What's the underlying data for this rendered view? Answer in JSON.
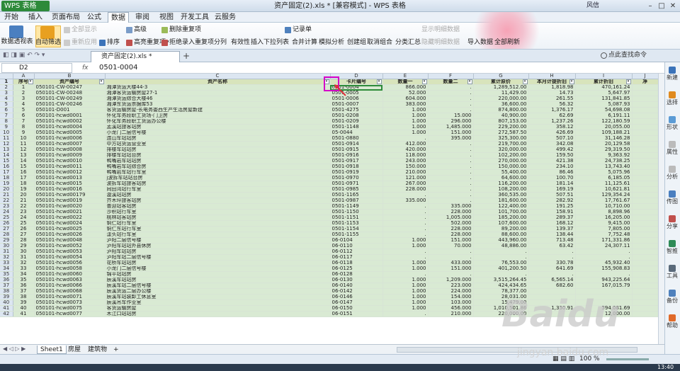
{
  "app": {
    "name": "WPS 表格",
    "title": "资产固定(2).xls * [兼容模式] - WPS 表格",
    "user": "风信14256100766"
  },
  "menus": [
    "开始",
    "插入",
    "页面布局",
    "公式",
    "数据",
    "审阅",
    "视图",
    "开发工具",
    "云服务"
  ],
  "active_menu_index": 4,
  "ribbon": {
    "big": [
      "数据透视表",
      "自动筛选"
    ],
    "small": [
      "全部显示",
      "重新应用",
      "排序",
      "高级",
      "删除重复项",
      "拒绝录入重复项",
      "分列",
      "有效性",
      "插入下拉列表",
      "合并计算",
      "模拟分析",
      "记录单",
      "创建组",
      "取消组合",
      "分类汇总",
      "显示明细数据",
      "隐藏明细数据",
      "导入数据",
      "全部刷新",
      "点此查找命令"
    ]
  },
  "file_tab": "资产固定(2).xls *",
  "name_box": "D2",
  "fx": "fx",
  "formula_value": "0501-0004",
  "columns": [
    "A",
    "B",
    "C",
    "D",
    "E",
    "F",
    "G",
    "H",
    "I",
    "J"
  ],
  "headers": [
    "序号",
    "资产编号",
    "资产名称",
    "卡片编号",
    "数量一",
    "数量二",
    "累计原价",
    "本月计提折旧",
    "累计折旧",
    "净"
  ],
  "rows": [
    [
      "1",
      "050101-CW-00247",
      "湘潭货运大楼44-3",
      "0501-0004",
      "866.000",
      ".",
      "1,289,512.00",
      "1,818.98",
      "470,161.24"
    ],
    [
      "2",
      "050101-CW-00248",
      "湘潭客货运输房屋27-1",
      "0501-0005",
      "52.000",
      ".",
      "11,429.00",
      "14.73",
      "5,647.97"
    ],
    [
      "3",
      "050101-CW-00249",
      "湘潭货运综合大楼46",
      "0501-0006",
      "604.000",
      ".",
      "220,000.00",
      "261.55",
      "131,841.85"
    ],
    [
      "4",
      "050101-CW-00246",
      "湘潭东货运票据库53",
      "0501-0007",
      "383.000",
      ".",
      "36,600.00",
      "56.32",
      "5,087.93"
    ],
    [
      "5",
      "050101-D001",
      "客货运输房屋-长电务委西生产生活房屋新建",
      "0501-4275",
      "1.000",
      ".",
      "874,800.00",
      "1,376.17",
      "54,698.08"
    ],
    [
      "6",
      "050101-hcwd0001",
      "怀化车务段职工货场-门卫房",
      "0501-0208",
      "1.000",
      "15.000",
      "40,900.00",
      "62.69",
      "6,191.11"
    ],
    [
      "7",
      "050101-hcwd0002",
      "怀化车务段职工货运办公楼",
      "0501-0209",
      "1.000",
      "296.000",
      "807,153.00",
      "1,237.26",
      "122,180.59"
    ],
    [
      "8",
      "050101-hcwd0004",
      "孟溪站旅客站房",
      "0501-1148",
      "1.000",
      "1,485.000",
      "229,200.00",
      "358.12",
      "20,055.00"
    ],
    [
      "9",
      "050101-hcwd0005",
      "小龙门二层信号楼",
      "05-0044",
      "1.000",
      "151.000",
      "272,587.50",
      "426.69",
      "109,188.21"
    ],
    [
      "10",
      "050101-hcwd0006",
      "连山车站站房",
      "0501-0880",
      ".",
      "395.000",
      "325,300.00",
      "507.10",
      "31,146.28"
    ],
    [
      "11",
      "050101-hcwd0007",
      "中方站货运营业室",
      "0501-0914",
      "412.000",
      ".",
      "219,700.00",
      "342.08",
      "20,129.58"
    ],
    [
      "12",
      "050101-hcwd0008",
      "排楼车站站房",
      "0501-0915",
      "420.000",
      ".",
      "320,000.00",
      "499.42",
      "29,319.50"
    ],
    [
      "13",
      "050101-hcwd0009",
      "排楼车站站台房",
      "0501-0916",
      "118.000",
      ".",
      "102,200.00",
      "159.50",
      "9,363.92"
    ],
    [
      "14",
      "050101-hcwd0010",
      "鸭嘴岩车站站房",
      "0501-0917",
      "243.000",
      ".",
      "270,000.00",
      "421.38",
      "24,738.25"
    ],
    [
      "15",
      "050101-hcwd0011",
      "鸭嘴岩车站综合房",
      "0501-0918",
      "150.000",
      ".",
      "150,000.00",
      "234.10",
      "13,743.40"
    ],
    [
      "16",
      "050101-hcwd0012",
      "鸭嘴岩车站行车室",
      "0501-0919",
      "210.000",
      ".",
      "55,400.00",
      "86.46",
      "5,075.96"
    ],
    [
      "17",
      "050101-hcwd0013",
      "j波拆车站站台房",
      "0501-0970",
      "121.000",
      ".",
      "64,600.00",
      "100.70",
      "6,185.05"
    ],
    [
      "18",
      "050101-hcwd0015",
      "波拆车站旅客站房",
      "0501-0971",
      "267.000",
      ".",
      "116,200.00",
      "181.14",
      "11,125.61"
    ],
    [
      "19",
      "050101-hcwd0016",
      "同田湾站行车室",
      "0501-0985",
      "228.000",
      ".",
      "108,200.00",
      "169.19",
      "10,621.81"
    ],
    [
      "20",
      "050101-hcwd00179",
      "漩溪站站房",
      "0501-1165",
      ".",
      ".",
      "360,535.00",
      "507.51",
      "129,354.24"
    ],
    [
      "21",
      "050101-hcwd0019",
      "芥木坪旅客站房",
      "0501-0987",
      "335.000",
      ".",
      "181,600.00",
      "282.92",
      "17,761.67"
    ],
    [
      "22",
      "050101-hcwd0020",
      "普迎站客站房",
      "0501-1149",
      ".",
      "335.000",
      "122,400.00",
      "191.25",
      "10,710.00"
    ],
    [
      "23",
      "050101-hcwd0021",
      "沙积站行车室",
      "0501-1150",
      ".",
      "228.000",
      "101,700.00",
      "158.91",
      "8,898.96"
    ],
    [
      "24",
      "050101-hcwd0022",
      "桃林站客站房",
      "0501-1151",
      ".",
      "1,005.000",
      "185,200.00",
      "289.37",
      "16,205.00"
    ],
    [
      "25",
      "050101-hcwd0024",
      "铜仁站行车室",
      "0501-1153",
      ".",
      "502.000",
      "107,600.00",
      "168.12",
      "9,415.00"
    ],
    [
      "26",
      "050101-hcwd0025",
      "铜仁东站行车室",
      "0501-1154",
      ".",
      "228.000",
      "89,200.00",
      "139.37",
      "7,805.00"
    ],
    [
      "27",
      "050101-hcwd0026",
      "漾头站行车室",
      "0501-1155",
      ".",
      "228.000",
      "88,600.00",
      "138.44",
      "7,752.48"
    ],
    [
      "28",
      "050101-hcwd0048",
      "泸阳二层信号楼",
      "06-0104",
      "1.000",
      "151.000",
      "443,960.00",
      "713.48",
      "171,331.86"
    ],
    [
      "29",
      "050101-hcwd0052",
      "泸阳车站站外县休房",
      "06-0110",
      "1.000",
      "70.000",
      "48,886.00",
      "63.42",
      "24,307.11"
    ],
    [
      "30",
      "050101-hcwd0053",
      "泸阳车站站房",
      "06-0112",
      ".",
      ".",
      ".",
      ".",
      "."
    ],
    [
      "31",
      "050101-hcwd0054",
      "泸阳车站二层信号楼",
      "06-0117",
      ".",
      ".",
      ".",
      ".",
      "."
    ],
    [
      "32",
      "050101-hcwd0056",
      "花桥车站站房",
      "06-0118",
      "1.000",
      "433.000",
      "76,553.00",
      "330.78",
      "45,932.40"
    ],
    [
      "33",
      "050101-hcwd0058",
      "小龙门二层信号楼",
      "06-0125",
      "1.000",
      "151.000",
      "401,200.50",
      "641.69",
      "155,908.83"
    ],
    [
      "34",
      "050101-hcwd0060",
      "锦平站站房",
      "06-0128",
      ".",
      ".",
      ".",
      ".",
      "."
    ],
    [
      "35",
      "050101-hcwd0063",
      "辰溪车站站房",
      "06-0130",
      "1.000",
      "1,209.000",
      "3,515,264.45",
      "6,565.14",
      "943,225.64"
    ],
    [
      "36",
      "050101-hcwd0066",
      "辰溪车站二层信号楼",
      "06-0140",
      "1.000",
      "223.000",
      "424,434.65",
      "682.60",
      "167,015.79"
    ],
    [
      "37",
      "050101-hcwd0068",
      "辰溪货运二层办公楼",
      "06-0142",
      "1.000",
      "224.000",
      "78,377.00",
      "",
      ""
    ],
    [
      "38",
      "050101-hcwd0071",
      "辰溪车站装卸工休息室",
      "06-0146",
      "1.000",
      "154.000",
      "28,031.00",
      "",
      ""
    ],
    [
      "39",
      "050101-hcwd0073",
      "辰溪吊车作业室",
      "06-0147",
      "1.000",
      "103.000",
      "15,479.00",
      "",
      ""
    ],
    [
      "40",
      "050101-hcwd0075",
      "客货运输房屋",
      "06-0150",
      "1.000",
      "456.000",
      "1,010,501.86",
      "1,330.91",
      "394,081.69"
    ],
    [
      "41",
      "050101-hcwd0077",
      "木江口站站房",
      "06-0151",
      ".",
      "210.000",
      "220,000.00",
      "",
      "12,000.00"
    ]
  ],
  "sheet_tabs": [
    "Sheet1",
    "房屋",
    "建筑物"
  ],
  "zoom": "100 %",
  "clock": "13:40",
  "side_items": [
    "新建",
    "选择",
    "形状",
    "属性",
    "分析",
    "传图",
    "分享",
    "智推",
    "工具",
    "备份",
    "帮助"
  ]
}
